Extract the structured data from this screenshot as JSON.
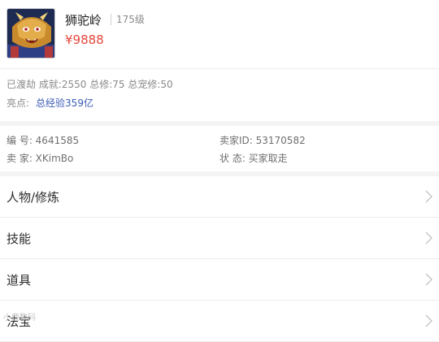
{
  "header": {
    "character_name": "狮驼岭",
    "level": "175级",
    "price": "¥9888"
  },
  "stats": {
    "summary": "已渡劫 成就:2550 总修:75 总宠修:50",
    "highlight_label": "亮点:",
    "highlight_value": "总经验359亿"
  },
  "listing_info": {
    "id_label_value": "编 号: 4641585",
    "seller_label_value": "卖 家: XKimBo",
    "seller_id_label_value": "卖家ID: 53170582",
    "status_label_value": "状 态: 买家取走"
  },
  "menu": {
    "items": [
      {
        "label": "人物/修炼",
        "icon": "chevron-right-icon"
      },
      {
        "label": "技能",
        "icon": "chevron-right-icon"
      },
      {
        "label": "道具",
        "icon": "chevron-right-icon"
      },
      {
        "label": "法宝",
        "icon": "chevron-right-icon"
      }
    ]
  },
  "watermark": "小鹿数码",
  "colors": {
    "price": "#e5473a",
    "highlight": "#3a5bb8",
    "muted_text": "#8a8a8a",
    "separator": "#f4f4f4"
  }
}
